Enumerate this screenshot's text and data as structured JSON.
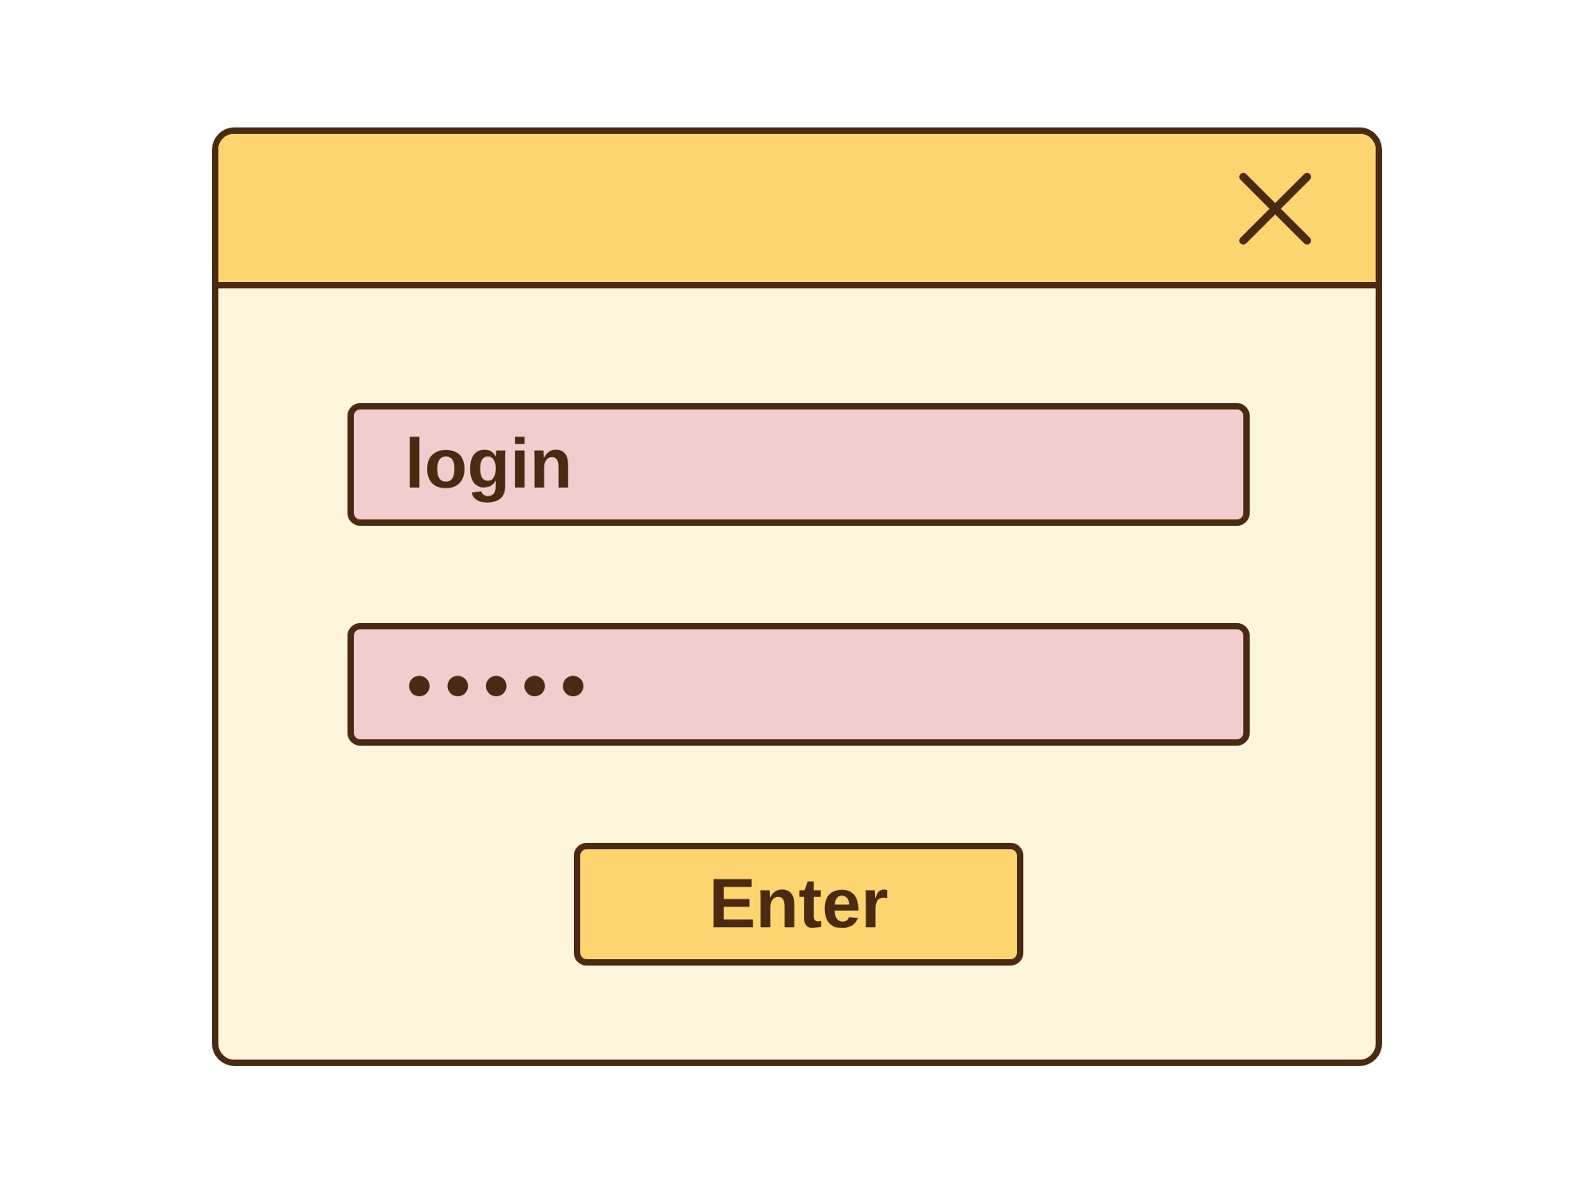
{
  "window": {
    "fields": [
      {
        "kind": "text",
        "value": "login"
      },
      {
        "kind": "password",
        "value": "●●●●●"
      }
    ],
    "button": "Enter"
  }
}
